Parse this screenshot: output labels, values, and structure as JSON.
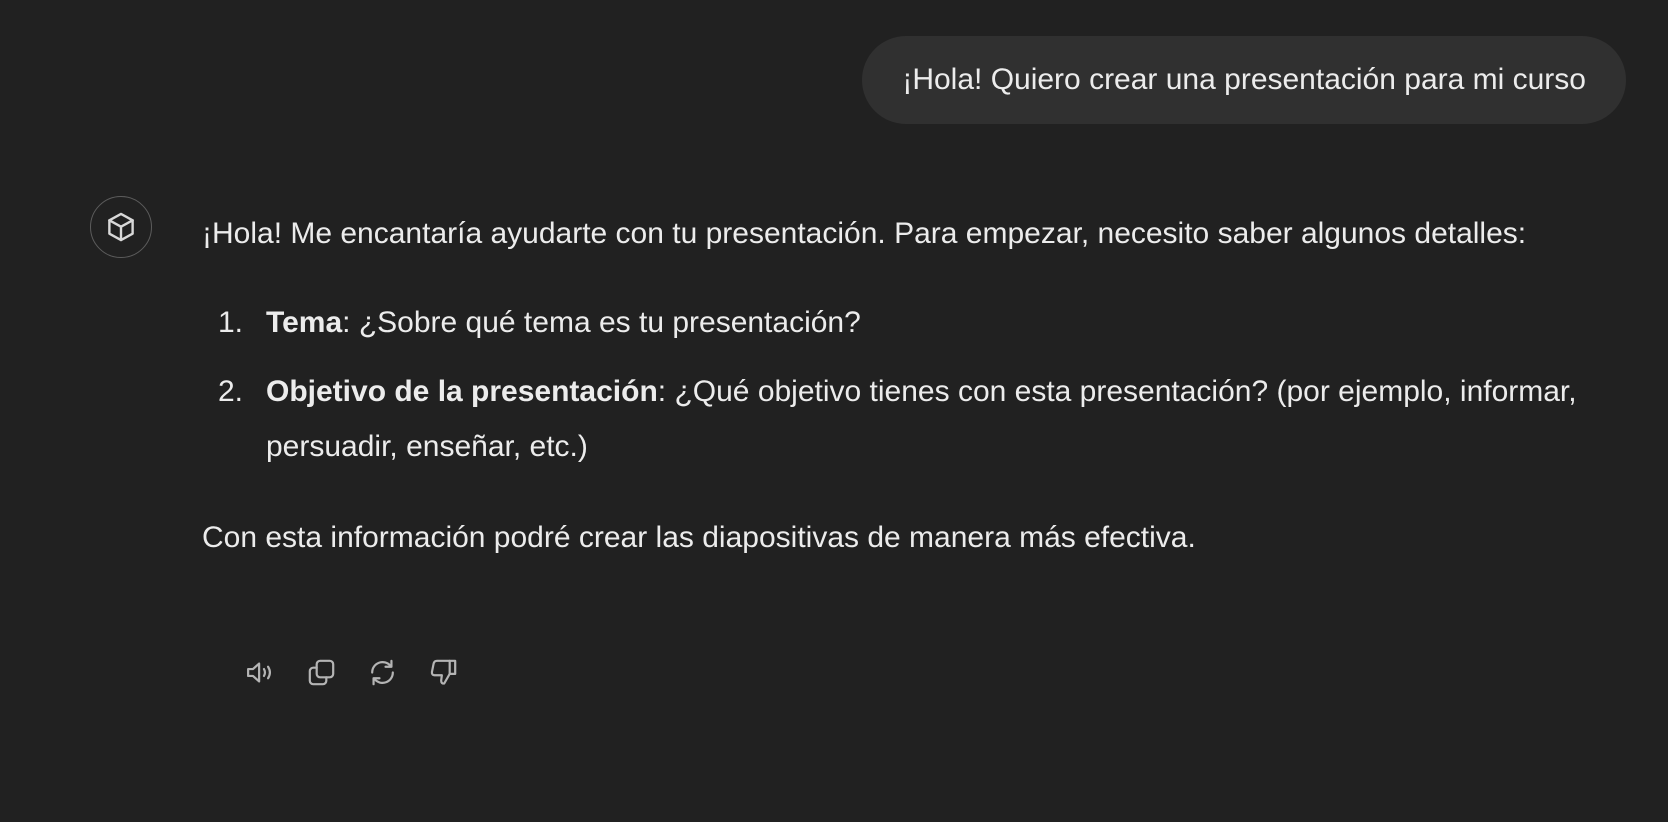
{
  "user_message": {
    "text": "¡Hola! Quiero crear una presentación para mi curso"
  },
  "assistant_message": {
    "avatar_icon": "box-icon",
    "intro": "¡Hola! Me encantaría ayudarte con tu presentación. Para empezar, necesito saber algunos detalles:",
    "items": [
      {
        "number": "1.",
        "title": "Tema",
        "text": ": ¿Sobre qué tema es tu presentación?"
      },
      {
        "number": "2.",
        "title": "Objetivo de la presentación",
        "text": ": ¿Qué objetivo tienes con esta presentación? (por ejemplo, informar, persuadir, enseñar, etc.)"
      }
    ],
    "closing": "Con esta información podré crear las diapositivas de manera más efectiva."
  },
  "actions": [
    {
      "icon": "speaker-icon"
    },
    {
      "icon": "copy-icon"
    },
    {
      "icon": "regenerate-icon"
    },
    {
      "icon": "thumbs-down-icon"
    }
  ],
  "colors": {
    "background": "#212121",
    "user_bubble": "#303030",
    "text": "#ececec",
    "icon": "#b4b4b4"
  }
}
